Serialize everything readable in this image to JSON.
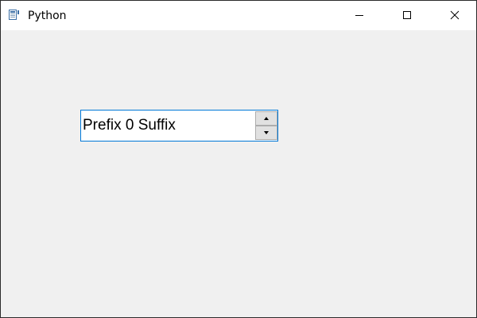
{
  "window": {
    "title": "Python",
    "app_icon": "python-app-icon",
    "controls": {
      "minimize_icon": "minimize-icon",
      "maximize_icon": "maximize-icon",
      "close_icon": "close-icon"
    }
  },
  "spinbox": {
    "prefix": "Prefix",
    "value": "0",
    "suffix": "Suffix",
    "display_text": "Prefix 0 Suffix",
    "up_icon": "arrow-up-icon",
    "down_icon": "arrow-down-icon",
    "focus_border_color": "#0078d7"
  },
  "colors": {
    "background": "#f0f0f0",
    "titlebar": "#ffffff"
  }
}
